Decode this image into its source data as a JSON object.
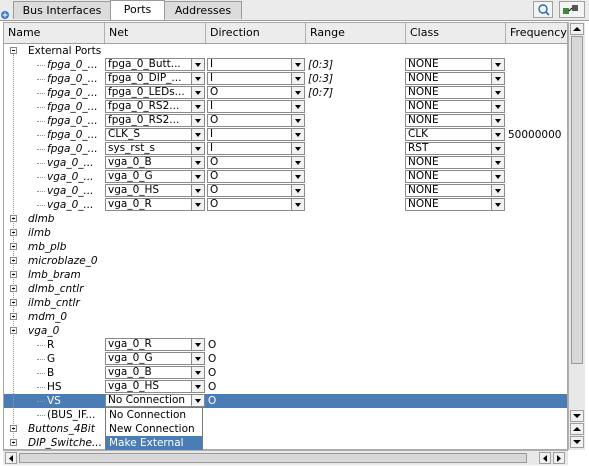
{
  "tabs": [
    "Bus Interfaces",
    "Ports",
    "Addresses"
  ],
  "columns": [
    "Name",
    "Net",
    "Direction",
    "Range",
    "Class",
    "Frequency(Hz)"
  ],
  "external_ports": {
    "label": "External Ports",
    "rows": [
      {
        "name": "fpga_0_...",
        "net": "fpga_0_Butt...",
        "dir": "I",
        "range": "[0:3]",
        "class": "NONE",
        "freq": ""
      },
      {
        "name": "fpga_0_...",
        "net": "fpga_0_DIP_...",
        "dir": "I",
        "range": "[0:3]",
        "class": "NONE",
        "freq": ""
      },
      {
        "name": "fpga_0_...",
        "net": "fpga_0_LEDs...",
        "dir": "O",
        "range": "[0:7]",
        "class": "NONE",
        "freq": ""
      },
      {
        "name": "fpga_0_...",
        "net": "fpga_0_RS2...",
        "dir": "I",
        "range": "",
        "class": "NONE",
        "freq": ""
      },
      {
        "name": "fpga_0_...",
        "net": "fpga_0_RS2...",
        "dir": "O",
        "range": "",
        "class": "NONE",
        "freq": ""
      },
      {
        "name": "fpga_0_...",
        "net": "CLK_S",
        "dir": "I",
        "range": "",
        "class": "CLK",
        "freq": "50000000"
      },
      {
        "name": "fpga_0_...",
        "net": "sys_rst_s",
        "dir": "I",
        "range": "",
        "class": "RST",
        "freq": ""
      },
      {
        "name": "vga_0_...",
        "net": "vga_0_B",
        "dir": "O",
        "range": "",
        "class": "NONE",
        "freq": ""
      },
      {
        "name": "vga_0_...",
        "net": "vga_0_G",
        "dir": "O",
        "range": "",
        "class": "NONE",
        "freq": ""
      },
      {
        "name": "vga_0_...",
        "net": "vga_0_HS",
        "dir": "O",
        "range": "",
        "class": "NONE",
        "freq": ""
      },
      {
        "name": "vga_0_...",
        "net": "vga_0_R",
        "dir": "O",
        "range": "",
        "class": "NONE",
        "freq": ""
      }
    ]
  },
  "collapsed_instances": [
    "dlmb",
    "ilmb",
    "mb_plb",
    "microblaze_0",
    "lmb_bram",
    "dlmb_cntlr",
    "ilmb_cntlr",
    "mdm_0"
  ],
  "vga_instance": {
    "label": "vga_0",
    "rows": [
      {
        "name": "R",
        "net": "vga_0_R",
        "dir": "O"
      },
      {
        "name": "G",
        "net": "vga_0_G",
        "dir": "O"
      },
      {
        "name": "B",
        "net": "vga_0_B",
        "dir": "O"
      },
      {
        "name": "HS",
        "net": "vga_0_HS",
        "dir": "O"
      },
      {
        "name": "VS",
        "net": "No Connection",
        "dir": "O"
      },
      {
        "name": "(BUS_IF...",
        "net": "",
        "dir": ""
      }
    ]
  },
  "trailing_instances": [
    "Buttons_4Bit",
    "DIP_Switche..."
  ],
  "dropdown_options": [
    "No Connection",
    "New Connection",
    "Make External"
  ],
  "dropdown_highlighted": "Make External",
  "colors": {
    "selection": "#4a7cb5",
    "header": "#ececec"
  }
}
